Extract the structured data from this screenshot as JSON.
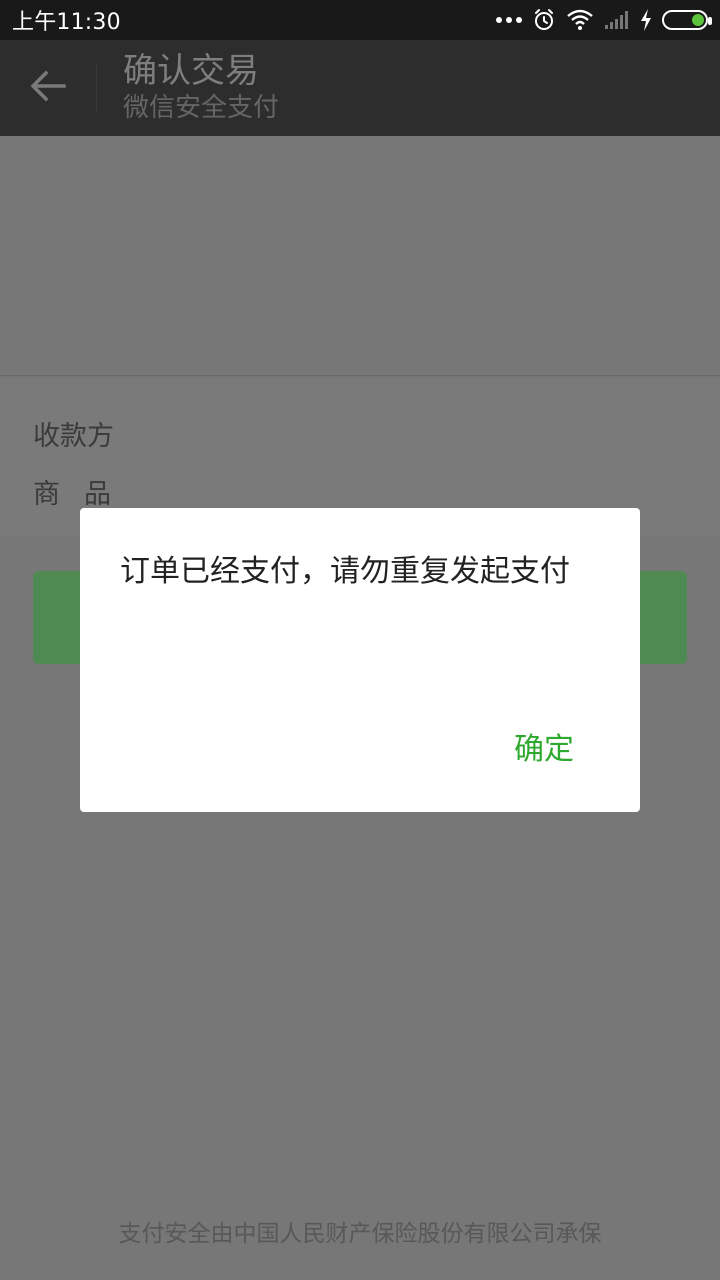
{
  "status_bar": {
    "time": "上午11:30",
    "icons": [
      "more-dots-icon",
      "alarm-icon",
      "wifi-icon",
      "signal-icon",
      "charging-icon",
      "battery-icon"
    ]
  },
  "title_bar": {
    "title": "确认交易",
    "subtitle": "微信安全支付",
    "back_icon": "back-arrow-icon"
  },
  "content": {
    "payee_label": "收款方",
    "goods_label": "商品"
  },
  "footer": {
    "text": "支付安全由中国人民财产保险股份有限公司承保"
  },
  "dialog": {
    "message": "订单已经支付，请勿重复发起支付",
    "confirm_label": "确定"
  },
  "colors": {
    "accent_green": "#2fa82f",
    "title_bar_bg": "#2d2d2d",
    "status_bar_bg": "#191919"
  }
}
